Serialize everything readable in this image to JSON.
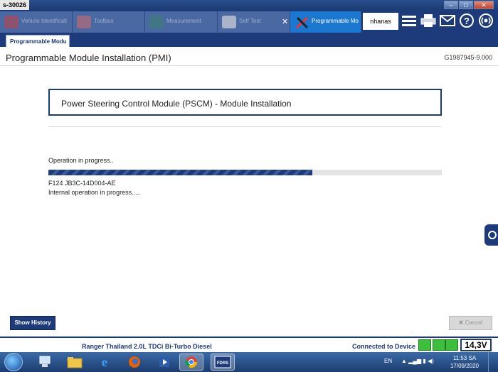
{
  "window": {
    "title": "s-30026"
  },
  "toolbar": {
    "tabs": [
      {
        "label": "Vehicle Identificati"
      },
      {
        "label": "Toolbox"
      },
      {
        "label": "Measurement"
      },
      {
        "label": "Self Test"
      },
      {
        "label": "Programmable Mo"
      }
    ],
    "user": "nhanas",
    "icons": [
      "menu-icon",
      "printer-icon",
      "mail-icon",
      "help-icon",
      "connection-icon"
    ]
  },
  "subtab": {
    "label": "Programmable Modu"
  },
  "page": {
    "title": "Programmable Module Installation (PMI)",
    "code": "G1987945-9.000"
  },
  "module": {
    "title": "Power Steering Control Module (PSCM) - Module Installation"
  },
  "progress": {
    "status": "Operation in progress..",
    "value": 0.67,
    "part_number": "F124 JB3C-14D004-AE",
    "internal_status": "Internal operation in progress....."
  },
  "buttons": {
    "show_history": "Show History",
    "cancel": "✖ Cancel"
  },
  "status_bar": {
    "vehicle": "Ranger  Thailand 2.0L TDCi Bi-Turbo Diesel",
    "connection": "Connected to Device",
    "voltage": "14,3V"
  },
  "taskbar": {
    "language": "EN",
    "time": "11:53 SA",
    "date": "17/09/2020"
  },
  "colors": {
    "accent": "#1d3b7a",
    "highlight": "#1b78d0",
    "ok": "#3cc03c"
  }
}
